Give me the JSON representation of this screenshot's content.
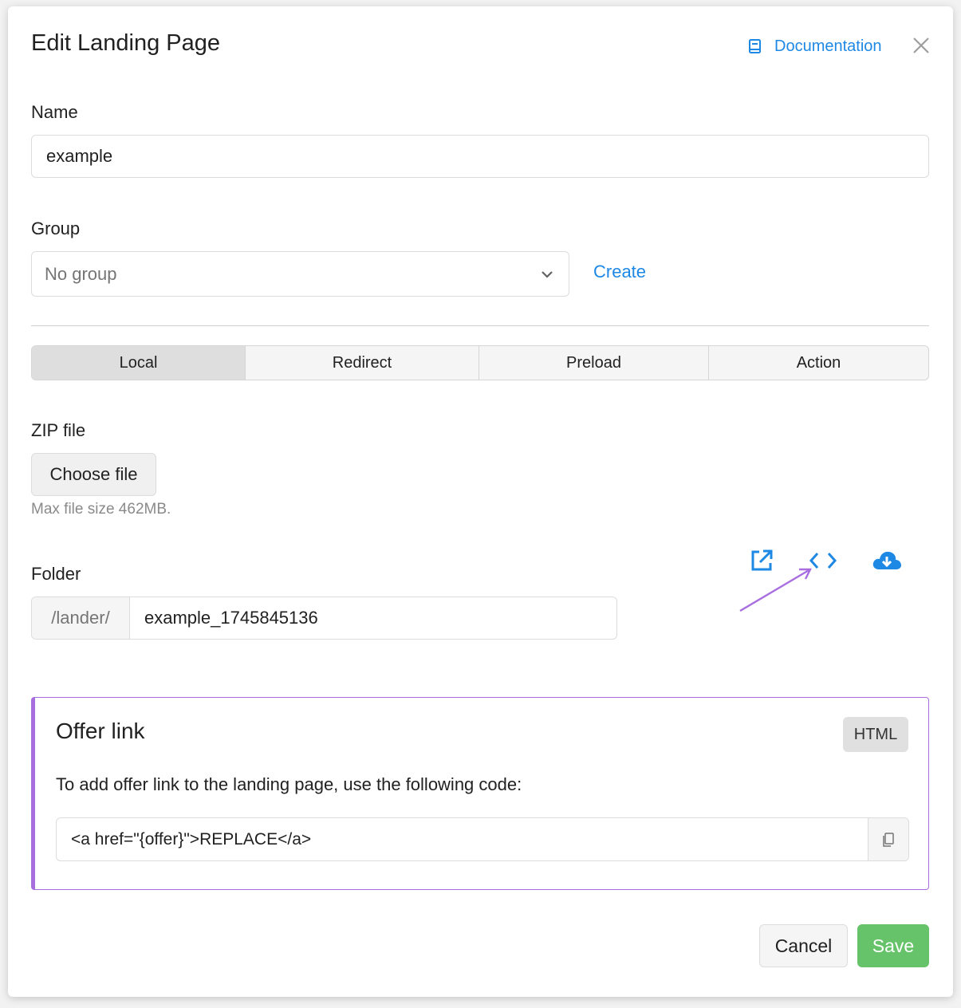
{
  "dialog": {
    "title": "Edit Landing Page",
    "documentation_label": "Documentation"
  },
  "name_field": {
    "label": "Name",
    "value": "example"
  },
  "group_field": {
    "label": "Group",
    "selected": "No group",
    "create_label": "Create"
  },
  "tabs": [
    {
      "label": "Local",
      "active": true
    },
    {
      "label": "Redirect",
      "active": false
    },
    {
      "label": "Preload",
      "active": false
    },
    {
      "label": "Action",
      "active": false
    }
  ],
  "zip": {
    "label": "ZIP file",
    "button_label": "Choose file",
    "hint": "Max file size 462MB."
  },
  "folder": {
    "label": "Folder",
    "prefix": "/lander/",
    "value": "example_1745845136",
    "actions": [
      "open-external-icon",
      "code-icon",
      "cloud-download-icon"
    ]
  },
  "offer_link": {
    "title": "Offer link",
    "badge": "HTML",
    "description": "To add offer link to the landing page, use the following code:",
    "code": "<a href=\"{offer}\">REPLACE</a>"
  },
  "footer": {
    "cancel_label": "Cancel",
    "save_label": "Save"
  },
  "colors": {
    "accent": "#1e88e5",
    "offer_border": "#a86ee0",
    "save": "#66c36a"
  }
}
